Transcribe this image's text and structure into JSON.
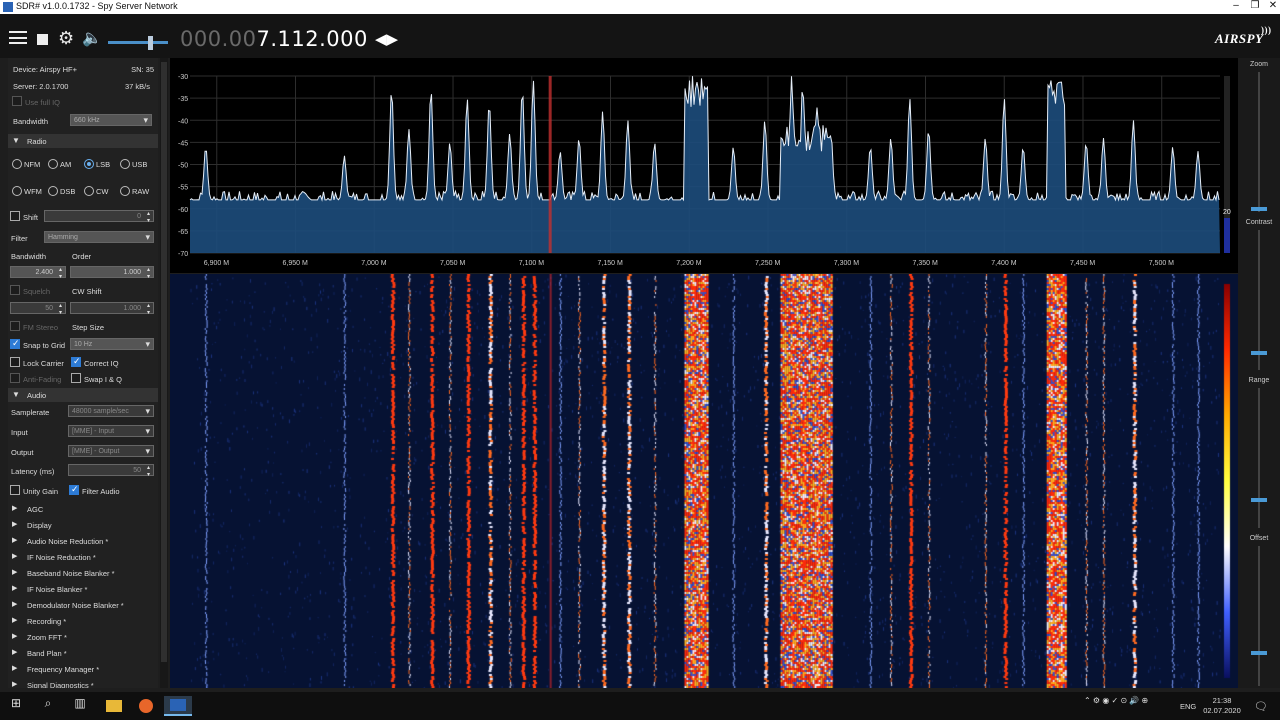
{
  "window": {
    "title": "SDR# v1.0.0.1732 - Spy Server Network",
    "minimize": "–",
    "maximize": "❐",
    "close": "✕"
  },
  "toolbar": {
    "freq_dim": "000.00",
    "freq_main": "7.112.000",
    "menu_icon": "menu-icon",
    "stop_icon": "stop-icon",
    "gear_icon": "gear-icon",
    "speaker_icon": "speaker-icon",
    "volume_level": 0.7,
    "logo": "AIRSPY",
    "gear_glyph": "⚙",
    "speaker_glyph": "🔈",
    "arrows_glyph": "◀▶"
  },
  "source": {
    "device": "Device: Airspy HF+",
    "sn": "SN: 35",
    "server": "Server: 2.0.1700",
    "rate": "37 kB/s",
    "use_full_iq": "Use full IQ",
    "bandwidth_label": "Bandwidth",
    "bandwidth_value": "660 kHz"
  },
  "radio": {
    "header": "Radio",
    "modes": [
      "NFM",
      "AM",
      "LSB",
      "USB",
      "WFM",
      "DSB",
      "CW",
      "RAW"
    ],
    "selected_mode": "LSB",
    "shift_label": "Shift",
    "shift_value": "0",
    "filter_label": "Filter",
    "filter_value": "Hamming",
    "bandwidth_label": "Bandwidth",
    "order_label": "Order",
    "bandwidth_value": "2.400",
    "order_value": "1.000",
    "squelch_label": "Squelch",
    "cw_shift_label": "CW Shift",
    "squelch_value": "50",
    "cw_shift_value": "1.000",
    "fm_stereo": "FM Stereo",
    "step_size": "Step Size",
    "snap_to_grid": "Snap to Grid",
    "step_value": "10 Hz",
    "lock_carrier": "Lock Carrier",
    "correct_iq": "Correct IQ",
    "anti_fading": "Anti-Fading",
    "swap_iq": "Swap I & Q"
  },
  "audio": {
    "header": "Audio",
    "samplerate_label": "Samplerate",
    "samplerate_value": "48000 sample/sec",
    "input_label": "Input",
    "input_value": "[MME] - Input",
    "output_label": "Output",
    "output_value": "[MME] - Output",
    "latency_label": "Latency (ms)",
    "latency_value": "50",
    "unity_gain": "Unity Gain",
    "filter_audio": "Filter Audio"
  },
  "plugins": [
    "AGC",
    "Display",
    "Audio Noise Reduction *",
    "IF Noise Reduction *",
    "Baseband Noise Blanker *",
    "IF Noise Blanker *",
    "Demodulator Noise Blanker *",
    "Recording *",
    "Zoom FFT *",
    "Band Plan *",
    "Frequency Manager *",
    "Signal Diagnostics *"
  ],
  "chart_data": {
    "type": "line",
    "title": "",
    "xlabel": "",
    "ylabel": "",
    "x_ticks": [
      "6,900 M",
      "6,950 M",
      "7,000 M",
      "7,050 M",
      "7,100 M",
      "7,150 M",
      "7,200 M",
      "7,250 M",
      "7,300 M",
      "7,350 M",
      "7,400 M",
      "7,450 M",
      "7,500 M"
    ],
    "y_ticks": [
      "-30",
      "-35",
      "-40",
      "-45",
      "-50",
      "-55",
      "-60",
      "-65",
      "-70"
    ],
    "ylim": [
      -70,
      -30
    ],
    "xlim_mhz": [
      6.883,
      7.537
    ],
    "grid": true,
    "tuned_mhz": 7.112,
    "noise_floor_db": -58,
    "peaks": [
      {
        "f": 6.893,
        "db": -46
      },
      {
        "f": 6.981,
        "db": -48
      },
      {
        "f": 7.011,
        "db": -33
      },
      {
        "f": 7.022,
        "db": -42
      },
      {
        "f": 7.036,
        "db": -33
      },
      {
        "f": 7.048,
        "db": -45
      },
      {
        "f": 7.059,
        "db": -35
      },
      {
        "f": 7.073,
        "db": -36
      },
      {
        "f": 7.086,
        "db": -43
      },
      {
        "f": 7.094,
        "db": -33
      },
      {
        "f": 7.101,
        "db": -31
      },
      {
        "f": 7.118,
        "db": -47
      },
      {
        "f": 7.13,
        "db": -44
      },
      {
        "f": 7.145,
        "db": -38
      },
      {
        "f": 7.161,
        "db": -40
      },
      {
        "f": 7.178,
        "db": -45
      },
      {
        "f": 7.202,
        "db": -30
      },
      {
        "f": 7.208,
        "db": -30
      },
      {
        "f": 7.228,
        "db": -46
      },
      {
        "f": 7.248,
        "db": -40
      },
      {
        "f": 7.265,
        "db": -30
      },
      {
        "f": 7.272,
        "db": -32
      },
      {
        "f": 7.281,
        "db": -37
      },
      {
        "f": 7.29,
        "db": -43
      },
      {
        "f": 7.315,
        "db": -46
      },
      {
        "f": 7.328,
        "db": -44
      },
      {
        "f": 7.34,
        "db": -35
      },
      {
        "f": 7.352,
        "db": -42
      },
      {
        "f": 7.388,
        "db": -44
      },
      {
        "f": 7.4,
        "db": -35
      },
      {
        "f": 7.412,
        "db": -46
      },
      {
        "f": 7.43,
        "db": -30
      },
      {
        "f": 7.436,
        "db": -30
      },
      {
        "f": 7.452,
        "db": -45
      },
      {
        "f": 7.463,
        "db": -44
      },
      {
        "f": 7.482,
        "db": -40
      },
      {
        "f": 7.507,
        "db": -46
      },
      {
        "f": 7.523,
        "db": -47
      }
    ],
    "bands": [
      {
        "from": 7.197,
        "to": 7.212,
        "db": -31
      },
      {
        "from": 7.258,
        "to": 7.29,
        "db": -41
      },
      {
        "from": 7.427,
        "to": 7.439,
        "db": -31
      }
    ],
    "range_label": "20"
  },
  "right_panel": {
    "zoom": "Zoom",
    "contrast": "Contrast",
    "range": "Range",
    "offset": "Offset"
  },
  "taskbar": {
    "start_glyph": "⊞",
    "search_glyph": "⌕",
    "taskview_glyph": "▥",
    "tray_glyphs": "⌃ ⚙ ◉ ✓ ⊙ 🔊 ⊕",
    "lang": "ENG",
    "time": "21:38",
    "date": "02.07.2020",
    "notif_glyph": "🗨"
  }
}
